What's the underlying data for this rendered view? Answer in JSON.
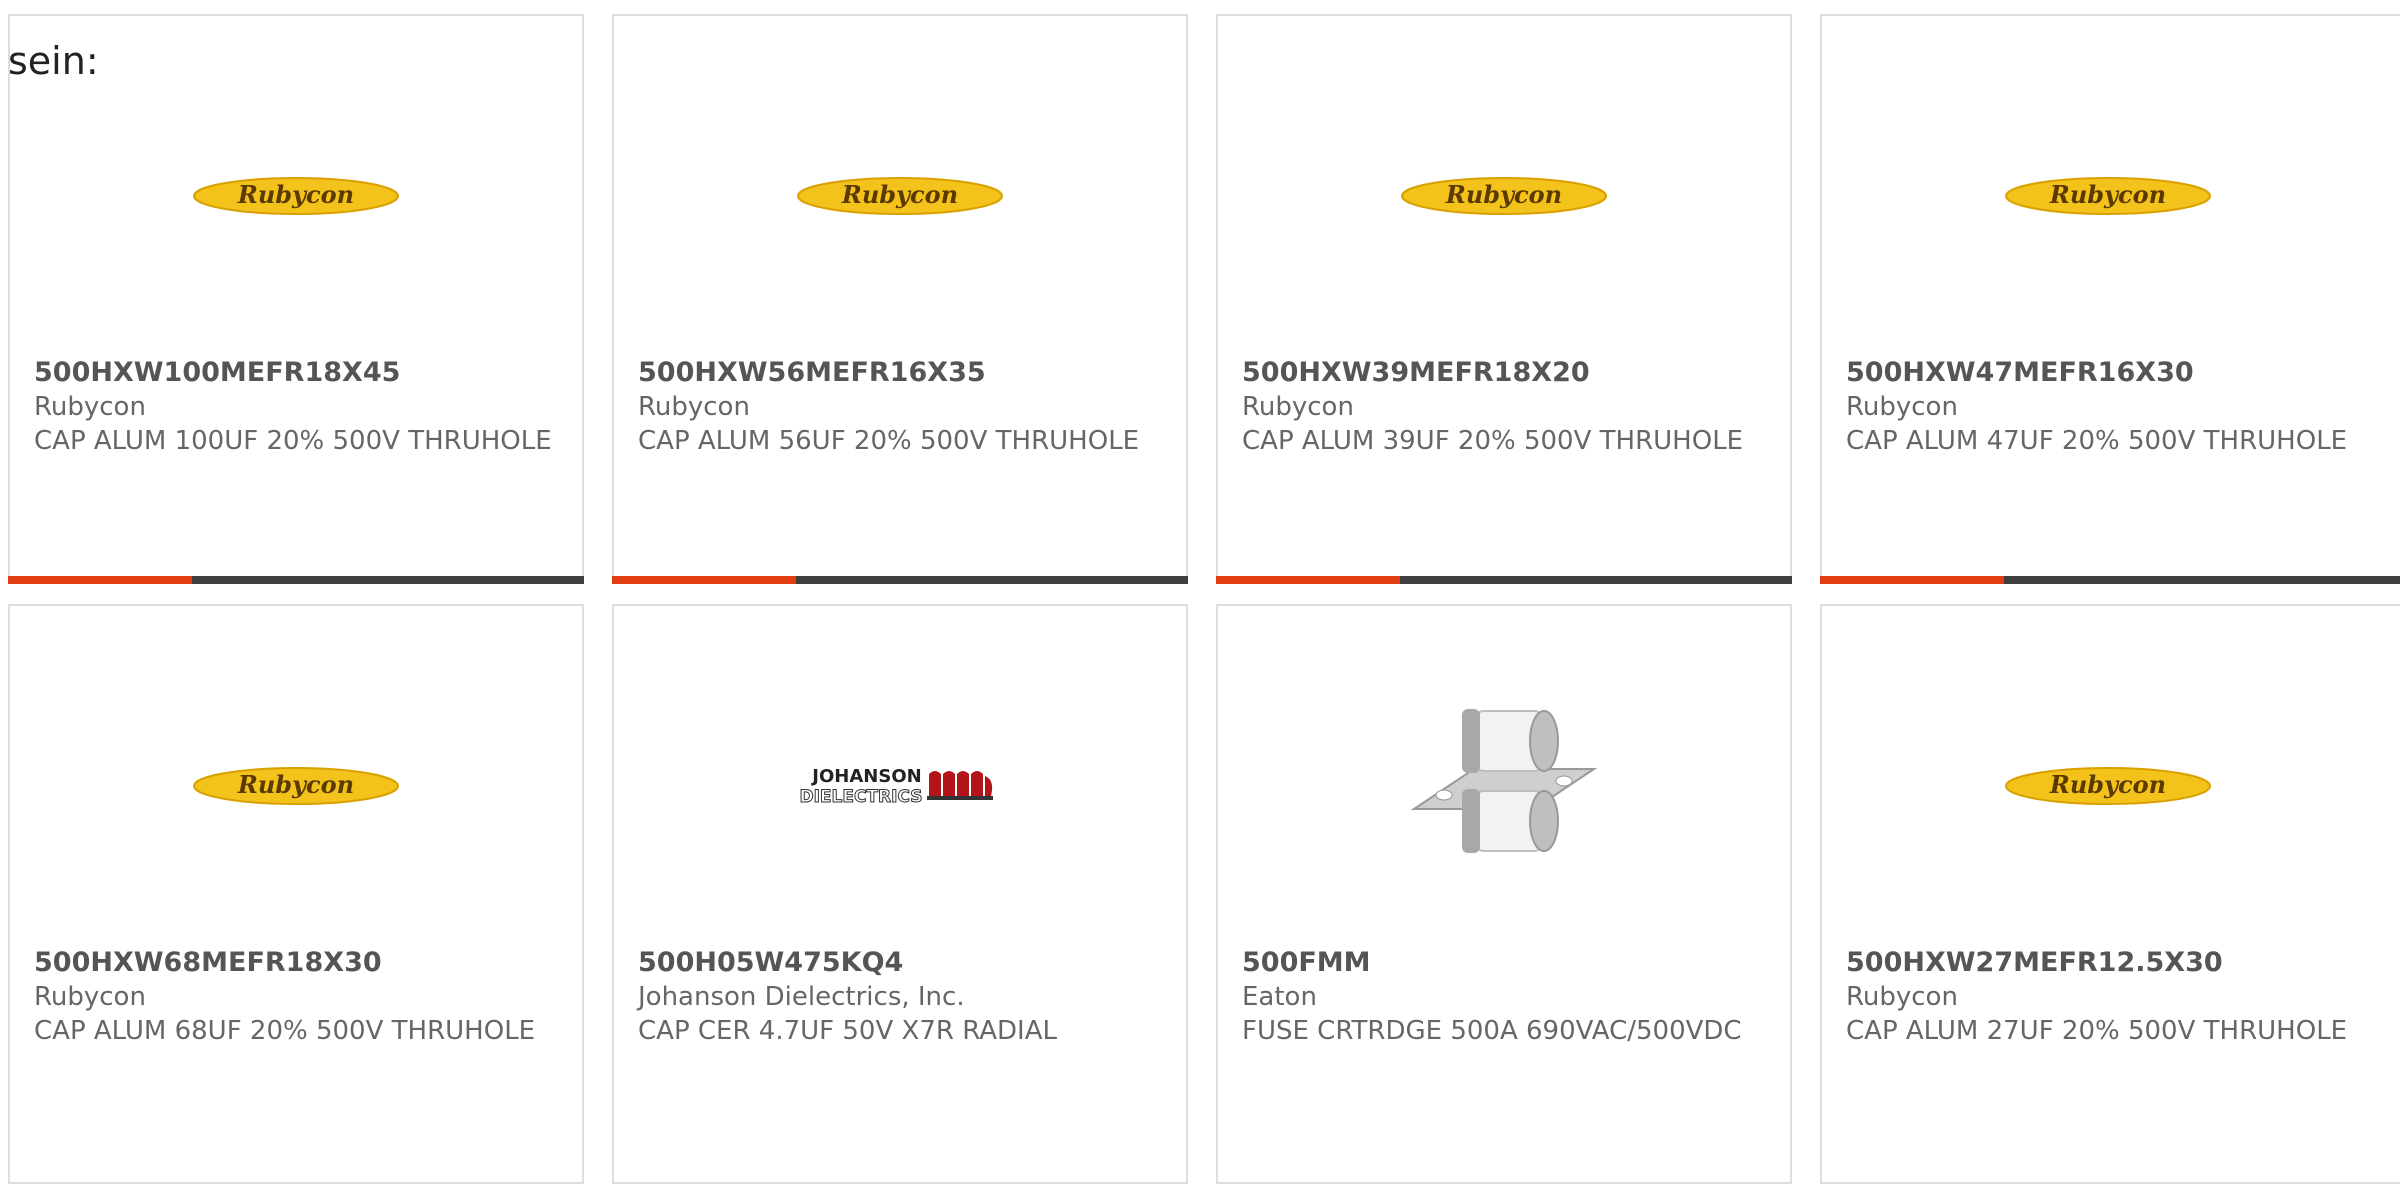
{
  "intro_text": "sein:",
  "colors": {
    "accent": "#e03e12",
    "bar": "#3f3f3f",
    "border": "#dddddd",
    "rubycon_yellow": "#f3c21b"
  },
  "products": [
    {
      "part": "500HXW100MEFR18X45",
      "brand": "Rubycon",
      "desc": "CAP ALUM 100UF 20% 500V THRUHOLE",
      "logo": "Rubycon"
    },
    {
      "part": "500HXW56MEFR16X35",
      "brand": "Rubycon",
      "desc": "CAP ALUM 56UF 20% 500V THRUHOLE",
      "logo": "Rubycon"
    },
    {
      "part": "500HXW39MEFR18X20",
      "brand": "Rubycon",
      "desc": "CAP ALUM 39UF 20% 500V THRUHOLE",
      "logo": "Rubycon"
    },
    {
      "part": "500HXW47MEFR16X30",
      "brand": "Rubycon",
      "desc": "CAP ALUM 47UF 20% 500V THRUHOLE",
      "logo": "Rubycon"
    },
    {
      "part": "500HXW68MEFR18X30",
      "brand": "Rubycon",
      "desc": "CAP ALUM 68UF 20% 500V THRUHOLE",
      "logo": "Rubycon"
    },
    {
      "part": "500H05W475KQ4",
      "brand": "Johanson Dielectrics, Inc.",
      "desc": "CAP CER 4.7UF 50V X7R RADIAL",
      "logo": "JOHANSON",
      "logo_sub": "DIELECTRICS"
    },
    {
      "part": "500FMM",
      "brand": "Eaton",
      "desc": "FUSE CRTRDGE 500A 690VAC/500VDC",
      "logo": "fuse-image"
    },
    {
      "part": "500HXW27MEFR12.5X30",
      "brand": "Rubycon",
      "desc": "CAP ALUM 27UF 20% 500V THRUHOLE",
      "logo": "Rubycon"
    }
  ]
}
